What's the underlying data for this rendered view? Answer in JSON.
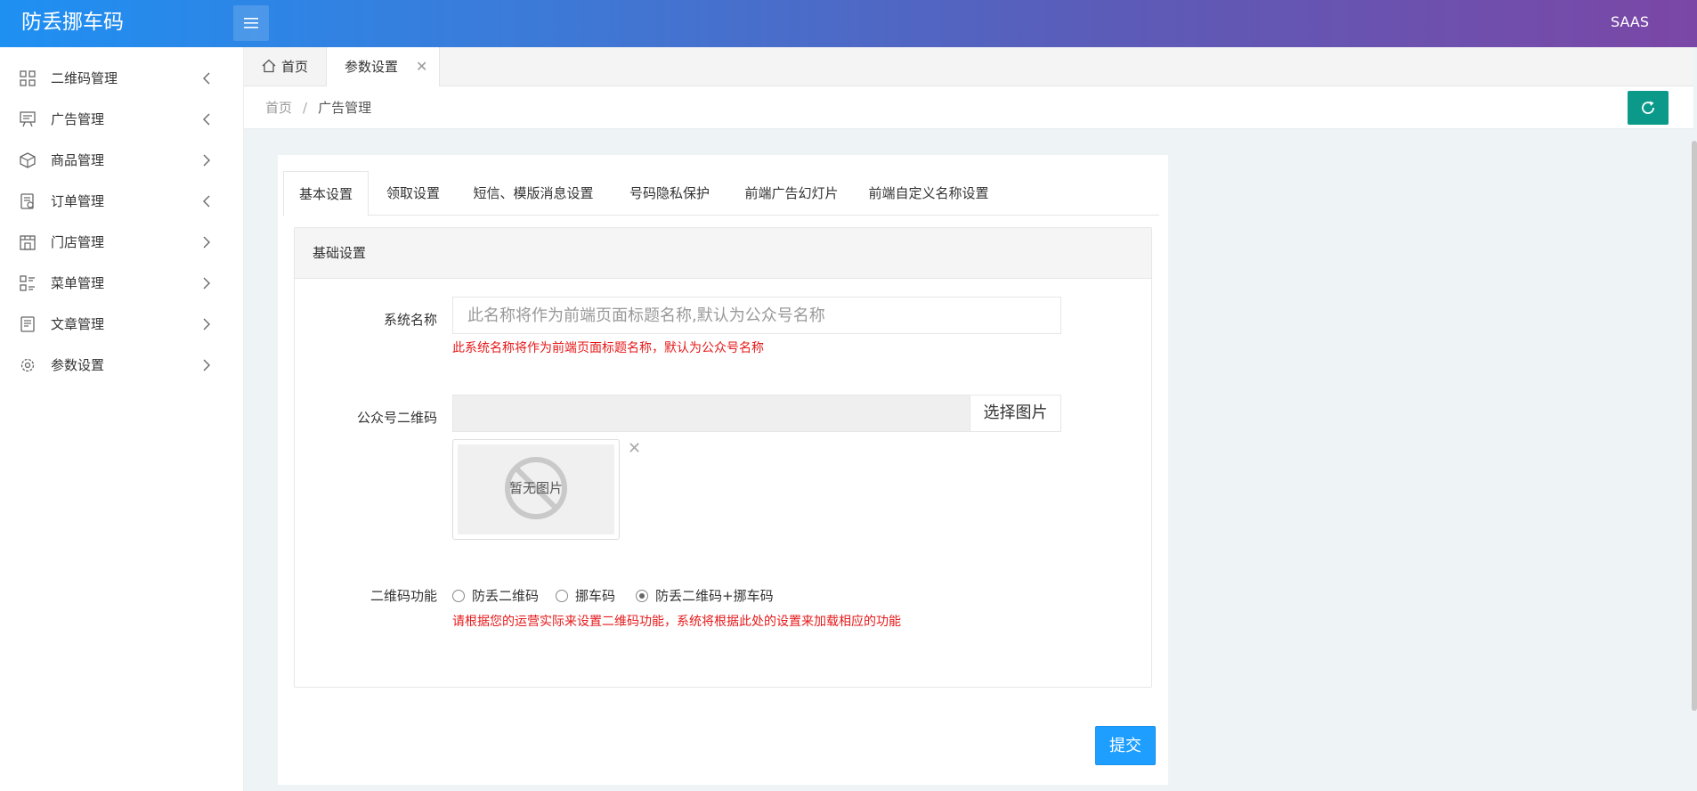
{
  "header": {
    "logo": "防丢挪车码",
    "right_label": "SAAS"
  },
  "sidebar": {
    "items": [
      {
        "label": "二维码管理",
        "icon": "qrcode-grid-icon",
        "chevron": "left"
      },
      {
        "label": "广告管理",
        "icon": "ad-board-icon",
        "chevron": "left"
      },
      {
        "label": "商品管理",
        "icon": "package-box-icon",
        "chevron": "right"
      },
      {
        "label": "订单管理",
        "icon": "order-doc-icon",
        "chevron": "left"
      },
      {
        "label": "门店管理",
        "icon": "store-icon",
        "chevron": "right"
      },
      {
        "label": "菜单管理",
        "icon": "menu-list-icon",
        "chevron": "right"
      },
      {
        "label": "文章管理",
        "icon": "article-icon",
        "chevron": "right"
      },
      {
        "label": "参数设置",
        "icon": "gear-icon",
        "chevron": "right"
      }
    ]
  },
  "tabs": {
    "home": "首页",
    "current": "参数设置",
    "close_glyph": "✕"
  },
  "breadcrumb": {
    "home": "首页",
    "separator": "/",
    "current": "广告管理"
  },
  "subtabs": [
    "基本设置",
    "领取设置",
    "短信、模版消息设置",
    "号码隐私保护",
    "前端广告幻灯片",
    "前端自定义名称设置"
  ],
  "panel": {
    "title": "基础设置",
    "system_name": {
      "label": "系统名称",
      "placeholder": "此名称将作为前端页面标题名称,默认为公众号名称",
      "value": "",
      "hint": "此系统名称将作为前端页面标题名称，默认为公众号名称"
    },
    "qrcode": {
      "label": "公众号二维码",
      "button": "选择图片",
      "no_image": "暂无图片",
      "delete_glyph": "✕"
    },
    "function": {
      "label": "二维码功能",
      "options": [
        "防丢二维码",
        "挪车码",
        "防丢二维码+挪车码"
      ],
      "selected": 2,
      "hint": "请根据您的运营实际来设置二维码功能，系统将根据此处的设置来加载相应的功能"
    }
  },
  "submit_label": "提交",
  "colors": {
    "accent_teal": "#0b9a8a",
    "primary_blue": "#1e9fff",
    "hint_red": "#e5191a"
  }
}
